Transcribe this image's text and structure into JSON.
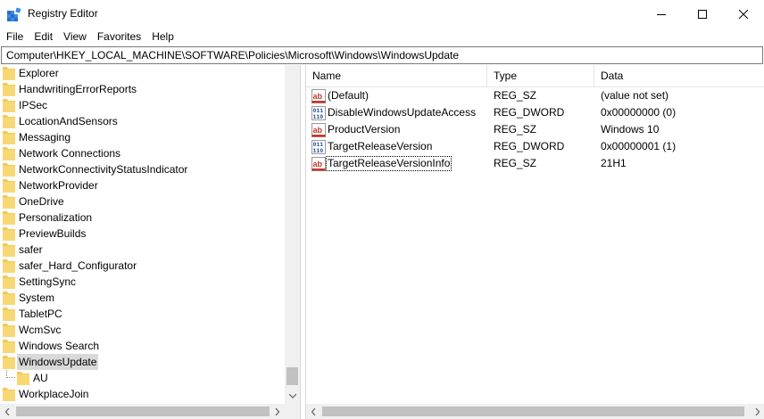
{
  "window": {
    "title": "Registry Editor"
  },
  "menu": [
    "File",
    "Edit",
    "View",
    "Favorites",
    "Help"
  ],
  "address": "Computer\\HKEY_LOCAL_MACHINE\\SOFTWARE\\Policies\\Microsoft\\Windows\\WindowsUpdate",
  "tree": {
    "items": [
      "Explorer",
      "HandwritingErrorReports",
      "IPSec",
      "LocationAndSensors",
      "Messaging",
      "Network Connections",
      "NetworkConnectivityStatusIndicator",
      "NetworkProvider",
      "OneDrive",
      "Personalization",
      "PreviewBuilds",
      "safer",
      "safer_Hard_Configurator",
      "SettingSync",
      "System",
      "TabletPC",
      "WcmSvc",
      "Windows Search",
      "WindowsUpdate",
      "AU",
      "WorkplaceJoin"
    ],
    "selected": "WindowsUpdate"
  },
  "list": {
    "columns": [
      "Name",
      "Type",
      "Data"
    ],
    "rows": [
      {
        "name": "(Default)",
        "type": "REG_SZ",
        "data": "(value not set)",
        "icon": "string-value-icon"
      },
      {
        "name": "DisableWindowsUpdateAccess",
        "type": "REG_DWORD",
        "data": "0x00000000 (0)",
        "icon": "binary-value-icon"
      },
      {
        "name": "ProductVersion",
        "type": "REG_SZ",
        "data": "Windows 10",
        "icon": "string-value-icon"
      },
      {
        "name": "TargetReleaseVersion",
        "type": "REG_DWORD",
        "data": "0x00000001 (1)",
        "icon": "binary-value-icon"
      },
      {
        "name": "TargetReleaseVersionInfo",
        "type": "REG_SZ",
        "data": "21H1",
        "icon": "string-value-icon"
      }
    ]
  },
  "colors": {
    "selection": "#d9d9d9",
    "folder": "#f5c94f",
    "scrollbar_track": "#f0f0f0",
    "scrollbar_thumb": "#c1c1c1"
  }
}
